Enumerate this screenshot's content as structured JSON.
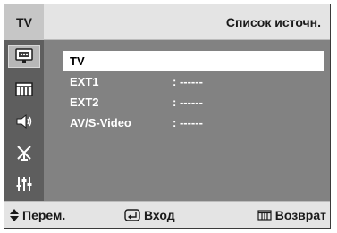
{
  "header": {
    "tab_label": "TV",
    "title": "Список источн."
  },
  "sidebar": {
    "items": [
      {
        "icon": "input-source-icon",
        "active": true
      },
      {
        "icon": "picture-icon",
        "active": false
      },
      {
        "icon": "sound-icon",
        "active": false
      },
      {
        "icon": "channel-antenna-icon",
        "active": false
      },
      {
        "icon": "setup-icon",
        "active": false
      }
    ]
  },
  "sources": [
    {
      "name": "TV",
      "value": "",
      "selected": true
    },
    {
      "name": "EXT1",
      "value": ": ------",
      "selected": false
    },
    {
      "name": "EXT2",
      "value": ": ------",
      "selected": false
    },
    {
      "name": "AV/S-Video",
      "value": ": ------",
      "selected": false
    }
  ],
  "footer": {
    "move_label": "Перем.",
    "enter_label": "Вход",
    "return_label": "Возврат"
  },
  "colors": {
    "panel_bg": "#828282",
    "sidebar_bg": "#5e5e5e",
    "bar_bg": "#e4e4e4",
    "highlight": "#ffffff"
  }
}
